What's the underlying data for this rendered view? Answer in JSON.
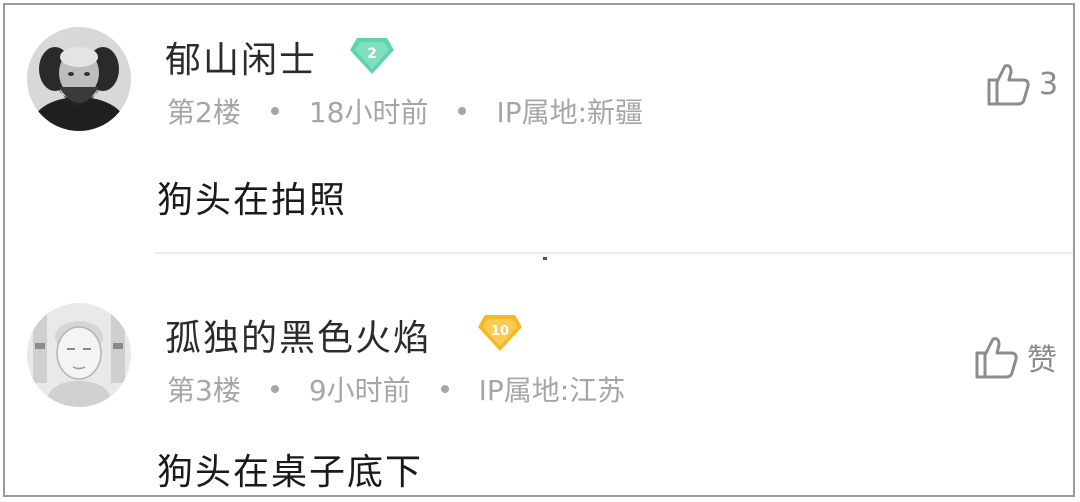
{
  "comments": [
    {
      "username": "郁山闲士",
      "level": "2",
      "floor": "第2楼",
      "time": "18小时前",
      "ip": "IP属地:新疆",
      "content": "狗头在拍照",
      "like_count": "3",
      "avatar_icon": "bearded-man-portrait",
      "badge_color": "#5fd3ad"
    },
    {
      "username": "孤独的黑色火焰",
      "level": "10",
      "floor": "第3楼",
      "time": "9小时前",
      "ip": "IP属地:江苏",
      "content": "狗头在桌子底下",
      "like_count": "赞",
      "avatar_icon": "sketch-portrait",
      "badge_color": "#f5b928"
    }
  ]
}
